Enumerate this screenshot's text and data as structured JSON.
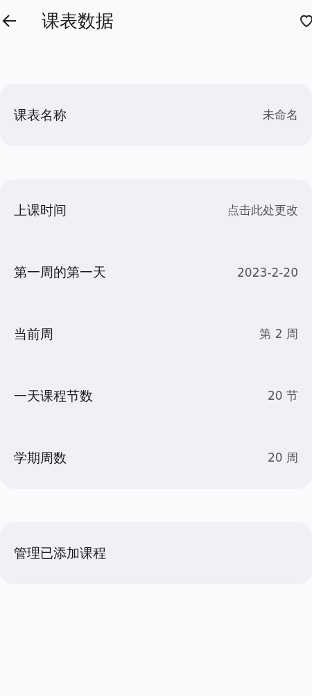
{
  "header": {
    "title": "课表数据"
  },
  "groups": [
    {
      "rows": [
        {
          "label": "课表名称",
          "value": "未命名"
        }
      ]
    },
    {
      "rows": [
        {
          "label": "上课时间",
          "value": "点击此处更改"
        },
        {
          "label": "第一周的第一天",
          "value": "2023-2-20"
        },
        {
          "label": "当前周",
          "value": "第 2 周"
        },
        {
          "label": "一天课程节数",
          "value": "20 节"
        },
        {
          "label": "学期周数",
          "value": "20 周"
        }
      ]
    },
    {
      "rows": [
        {
          "label": "管理已添加课程"
        }
      ]
    }
  ]
}
